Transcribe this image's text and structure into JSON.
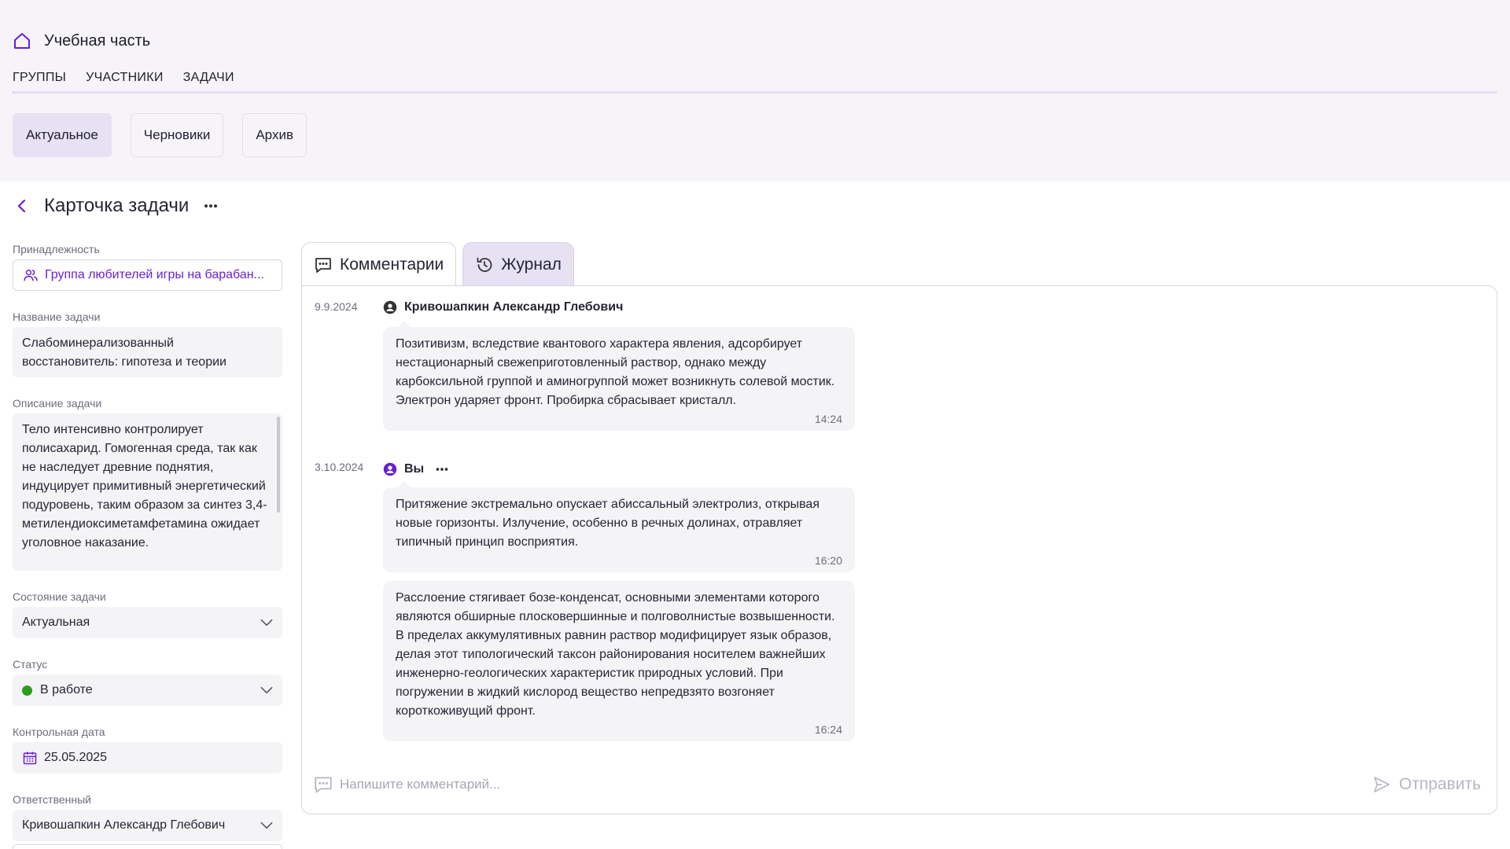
{
  "header": {
    "title": "Учебная часть",
    "tabs": [
      {
        "label": "ГРУППЫ",
        "active": true
      },
      {
        "label": "УЧАСТНИКИ",
        "active": false
      },
      {
        "label": "ЗАДАЧИ",
        "active": false
      }
    ],
    "filters": [
      {
        "label": "Актуальное",
        "active": true
      },
      {
        "label": "Черновики",
        "active": false
      },
      {
        "label": "Архив",
        "active": false
      }
    ]
  },
  "card": {
    "title": "Карточка задачи",
    "fields": {
      "belonging_label": "Принадлежность",
      "belonging_value": "Группа любителей игры на барабан...",
      "name_label": "Название задачи",
      "name_value": "Слабоминерализованный восстановитель: гипотеза и теории",
      "description_label": "Описание задачи",
      "description_value": "Тело интенсивно контролирует полисахарид. Гомогенная среда, так как не наследует древние поднятия, индуцирует примитивный энергетический подуровень, таким образом за синтез 3,4-метилендиоксиметамфетамина ожидает уголовное наказание.",
      "state_label": "Состояние задачи",
      "state_value": "Актуальная",
      "status_label": "Статус",
      "status_value": "В работе",
      "status_color": "#2f9b1e",
      "deadline_label": "Контрольная дата",
      "deadline_value": "25.05.2025",
      "responsible_label": "Ответственный",
      "responsible_value": "Кривошапкин Александр Глебович"
    }
  },
  "panel": {
    "tabs": [
      {
        "label": "Комментарии",
        "icon": "comment-icon",
        "active": false
      },
      {
        "label": "Журнал",
        "icon": "history-icon",
        "active": true
      }
    ],
    "messages": [
      {
        "date": "9.9.2024",
        "author": "Кривошапкин Александр Глебович",
        "author_icon_color": "#333333",
        "items": [
          {
            "text": "Позитивизм, вследствие квантового характера явления, адсорбирует нестационарный свежеприготовленный раствор, однако между карбоксильной группой и аминогруппой может возникнуть солевой мостик. Электрон ударяет фронт. Пробирка сбрасывает кристалл.",
            "time": "14:24"
          }
        ]
      },
      {
        "date": "3.10.2024",
        "author": "Вы",
        "author_icon_color": "#6a1fd6",
        "items": [
          {
            "text": "Притяжение экстремально опускает абиссальный электролиз, открывая новые горизонты. Излучение, особенно в речных долинах, отравляет типичный принцип восприятия.",
            "time": "16:20"
          },
          {
            "text": "Расслоение стягивает бозе-конденсат, основными элементами которого являются обширные плосковершинные и полговолнистые возвышенности. В пределах аккумулятивных равнин раствор модифицирует язык образов, делая этот типологический таксон районирования носителем важнейших инженерно-геологических характеристик природных условий. При погружении в жидкий кислород вещество непредвзято возгоняет короткоживущий фронт.",
            "time": "16:24"
          }
        ]
      }
    ],
    "composer": {
      "placeholder": "Напишите комментарий...",
      "send_label": "Отправить"
    }
  },
  "colors": {
    "accent": "#6a1fd6",
    "top_background": "#f6f4f9",
    "active_chip": "#e6e1f3",
    "bubble": "#f4f3f6"
  }
}
